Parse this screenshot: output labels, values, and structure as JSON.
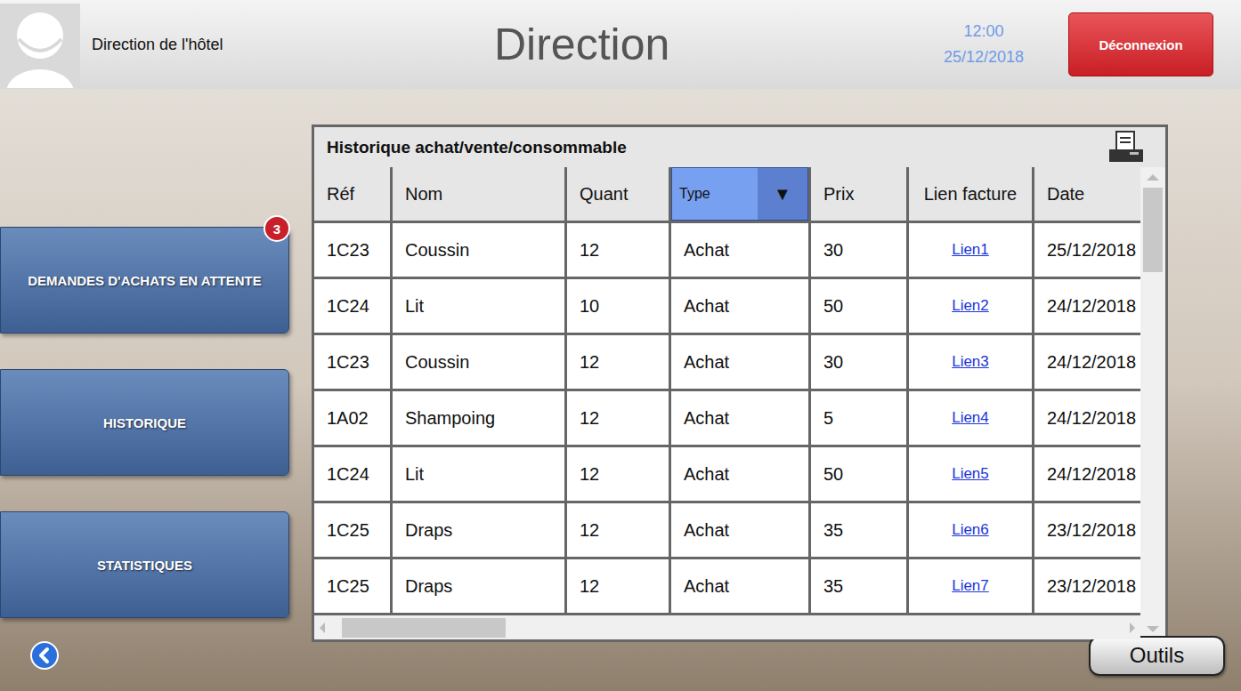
{
  "header": {
    "user": "Direction de l'hôtel",
    "title": "Direction",
    "time": "12:00",
    "date": "25/12/2018",
    "logout": "Déconnexion"
  },
  "sidebar": {
    "items": [
      {
        "label": "DEMANDES D'ACHATS EN ATTENTE",
        "badge": "3"
      },
      {
        "label": "HISTORIQUE"
      },
      {
        "label": "STATISTIQUES"
      }
    ]
  },
  "table": {
    "title": "Historique achat/vente/consommable",
    "columns": [
      {
        "label": "Réf",
        "key": "ref",
        "kind": "text"
      },
      {
        "label": "Nom",
        "key": "name",
        "kind": "text"
      },
      {
        "label": "Quant",
        "key": "quantity",
        "kind": "text"
      },
      {
        "label": "Type",
        "key": "type",
        "kind": "dropdown",
        "arrow": "▼"
      },
      {
        "label": "Prix",
        "key": "price",
        "kind": "text"
      },
      {
        "label": "Lien facture",
        "key": "invoice",
        "kind": "link"
      },
      {
        "label": "Date",
        "key": "date",
        "kind": "text"
      }
    ],
    "rows": [
      {
        "ref": "1C23",
        "name": "Coussin",
        "quantity": "12",
        "type": "Achat",
        "price": "30",
        "invoice": "Lien1",
        "date": "25/12/2018"
      },
      {
        "ref": "1C24",
        "name": "Lit",
        "quantity": "10",
        "type": "Achat",
        "price": "50",
        "invoice": "Lien2",
        "date": "24/12/2018"
      },
      {
        "ref": "1C23",
        "name": "Coussin",
        "quantity": "12",
        "type": "Achat",
        "price": "30",
        "invoice": "Lien3",
        "date": "24/12/2018"
      },
      {
        "ref": "1A02",
        "name": "Shampoing",
        "quantity": "12",
        "type": "Achat",
        "price": "5",
        "invoice": "Lien4",
        "date": "24/12/2018"
      },
      {
        "ref": "1C24",
        "name": "Lit",
        "quantity": "12",
        "type": "Achat",
        "price": "50",
        "invoice": "Lien5",
        "date": "24/12/2018"
      },
      {
        "ref": "1C25",
        "name": "Draps",
        "quantity": "12",
        "type": "Achat",
        "price": "35",
        "invoice": "Lien6",
        "date": "23/12/2018"
      },
      {
        "ref": "1C25",
        "name": "Draps",
        "quantity": "12",
        "type": "Achat",
        "price": "35",
        "invoice": "Lien7",
        "date": "23/12/2018"
      }
    ]
  },
  "footer": {
    "tools": "Outils"
  }
}
